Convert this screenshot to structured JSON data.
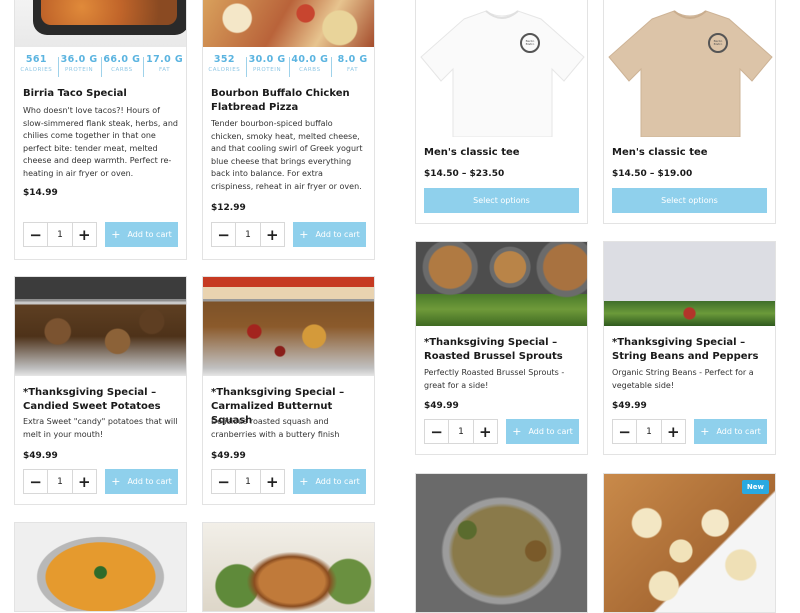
{
  "products": [
    {
      "id": "birria",
      "title": "Birria Taco Special",
      "description": "Who doesn't love tacos?! Hours of slow-simmered flank steak, herbs, and chilies come together in that one perfect bite: tender meat, melted cheese and deep warmth. Perfect re-heating in air fryer or oven.",
      "price": "$14.99",
      "qty": "1",
      "add_label": "Add to cart",
      "macros": [
        {
          "value": "561",
          "label": "CALORIES"
        },
        {
          "value": "36.0 G",
          "label": "PROTEIN"
        },
        {
          "value": "66.0 G",
          "label": "CARBS"
        },
        {
          "value": "17.0 G",
          "label": "FAT"
        }
      ]
    },
    {
      "id": "pizza",
      "title": "Bourbon Buffalo Chicken Flatbread Pizza",
      "description": "Tender bourbon-spiced buffalo chicken, smoky heat, melted cheese, and that cooling swirl of Greek yogurt blue cheese that brings everything back into balance. For extra crispiness, reheat in air fryer or oven.",
      "price": "$12.99",
      "qty": "1",
      "add_label": "Add to cart",
      "macros": [
        {
          "value": "352",
          "label": "CALORIES"
        },
        {
          "value": "30.0 G",
          "label": "PROTEIN"
        },
        {
          "value": "40.0 G",
          "label": "CARBS"
        },
        {
          "value": "8.0 G",
          "label": "FAT"
        }
      ]
    },
    {
      "id": "tee-white",
      "title": "Men's classic tee",
      "price": "$14.50 – $23.50",
      "options_label": "Select options",
      "logo": "Bento Bistro"
    },
    {
      "id": "tee-tan",
      "title": "Men's classic tee",
      "price": "$14.50 – $19.00",
      "options_label": "Select options",
      "logo": "Bento Bistro"
    },
    {
      "id": "sweet-potatoes",
      "title": "*Thanksgiving Special – Candied Sweet Potatoes",
      "description": "Extra Sweet \"candy\" potatoes that will melt in your mouth!",
      "price": "$49.99",
      "qty": "1",
      "add_label": "Add to cart"
    },
    {
      "id": "squash",
      "title": "*Thanksgiving Special – Carmalized Butternut Squash",
      "description": "Delicious roasted squash and cranberries with a buttery finish",
      "price": "$49.99",
      "qty": "1",
      "add_label": "Add to cart"
    },
    {
      "id": "brussel",
      "title": "*Thanksgiving Special – Roasted Brussel Sprouts",
      "description": "Perfectly Roasted Brussel Sprouts - great for a side!",
      "price": "$49.99",
      "qty": "1",
      "add_label": "Add to cart"
    },
    {
      "id": "string-beans",
      "title": "*Thanksgiving Special – String Beans and Peppers",
      "description": "Organic String Beans - Perfect for a vegetable side!",
      "price": "$49.99",
      "qty": "1",
      "add_label": "Add to cart"
    },
    {
      "id": "soup"
    },
    {
      "id": "turkey"
    },
    {
      "id": "stuffing"
    },
    {
      "id": "banana-dessert",
      "badge": "New"
    }
  ],
  "icons": {
    "minus": "minus-icon",
    "plus": "plus-icon",
    "cart_plus": "plus-icon"
  },
  "colors": {
    "accent": "#8fd0ec",
    "macro_text": "#5bb4e0",
    "badge": "#29a9e1"
  }
}
